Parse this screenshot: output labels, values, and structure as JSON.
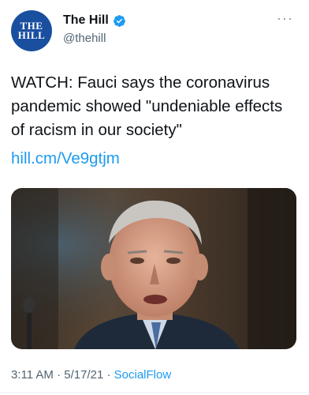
{
  "account": {
    "display_name": "The Hill",
    "handle": "@thehill",
    "avatar_line1": "THE",
    "avatar_line2": "HILL",
    "verified": true
  },
  "tweet": {
    "text": "WATCH: Fauci says the coronavirus pandemic showed \"undeniable effects of racism in our society\"",
    "link": "hill.cm/Ve9gtjm",
    "media_description": "photo",
    "time": "3:11 AM",
    "date": "5/17/21",
    "source": "SocialFlow"
  },
  "colors": {
    "link": "#1d9bf0",
    "secondary_text": "#536471",
    "avatar_bg": "#1a4fa0"
  },
  "icons": {
    "verified": "verified-badge-icon",
    "more": "more-options-icon"
  }
}
